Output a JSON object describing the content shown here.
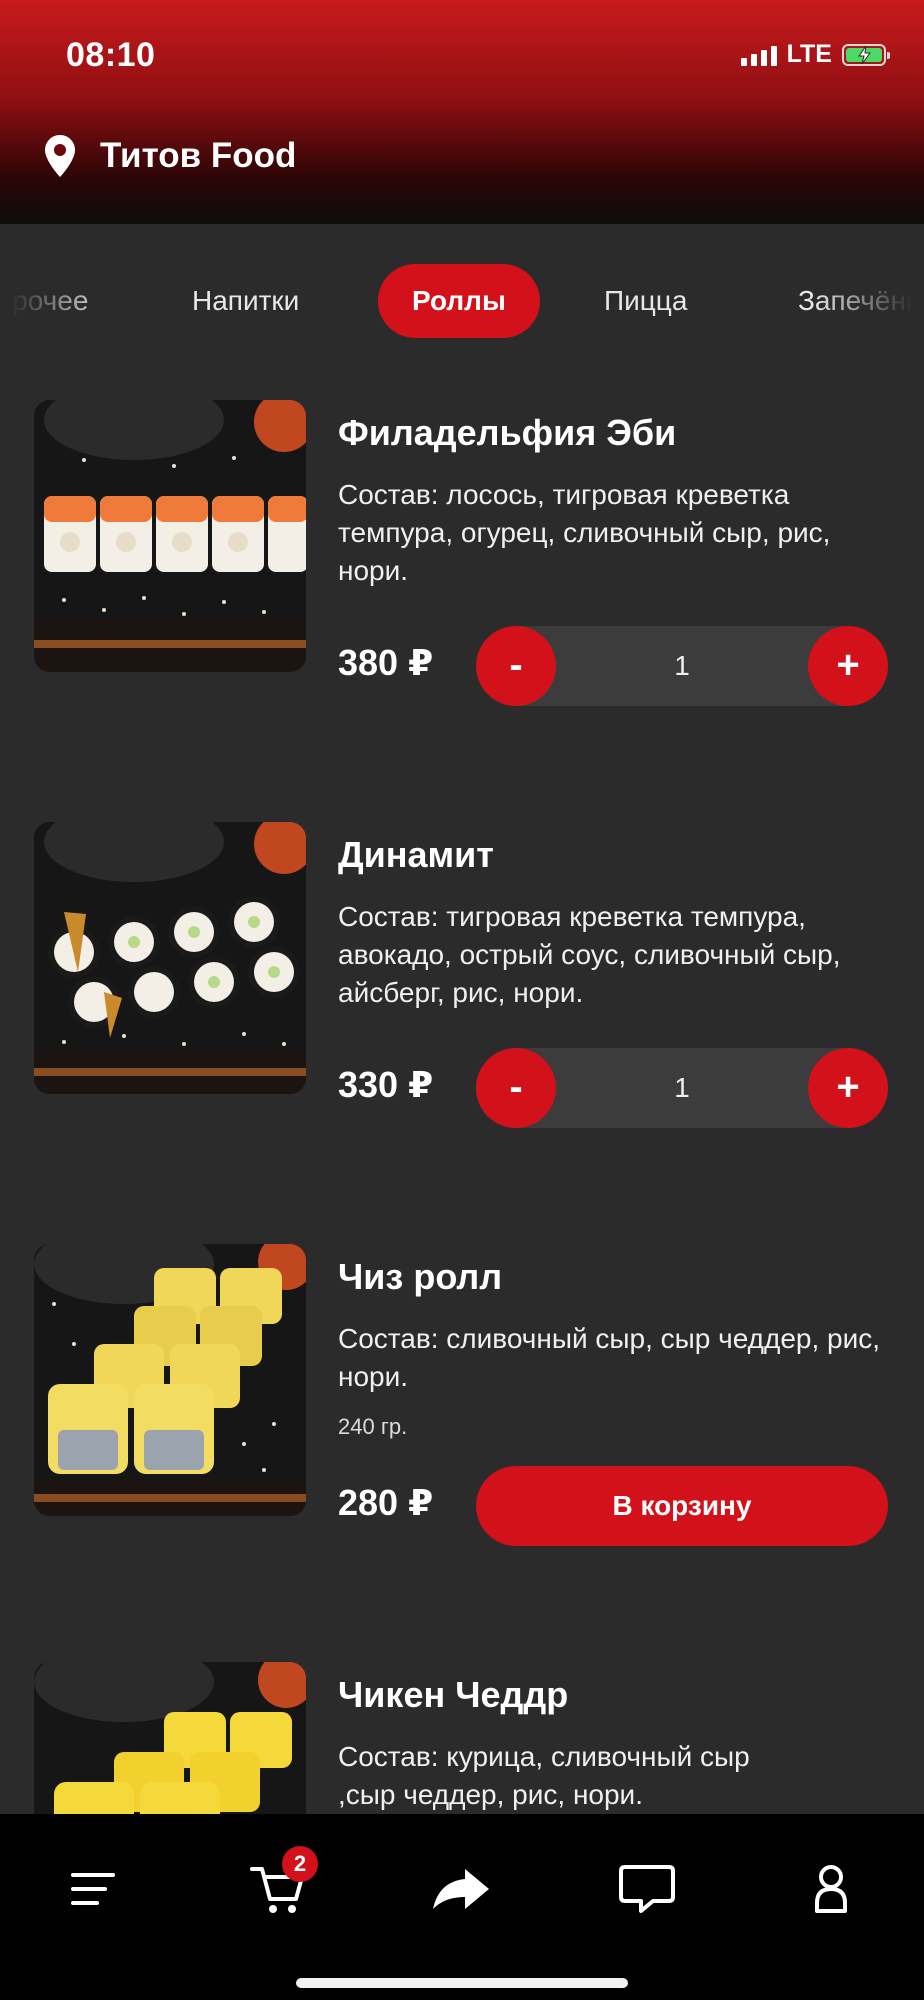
{
  "status_bar": {
    "time": "08:10",
    "network": "LTE",
    "battery_color": "#4cd964"
  },
  "header": {
    "location_icon": "map-pin-icon",
    "app_title": "Титов Food",
    "accent_color": "#d2111b"
  },
  "categories": {
    "items": [
      "Прочее",
      "Напитки",
      "Роллы",
      "Пицца",
      "Запечённые"
    ],
    "selected": "Роллы"
  },
  "products": [
    {
      "name": "Филадельфия Эби",
      "description": "Состав: лосось, тигровая креветка темпура, огурец, сливочный сыр, рис, нори.",
      "price": "380 ₽",
      "quantity": "1",
      "minus_label": "-",
      "plus_label": "+"
    },
    {
      "name": "Динамит",
      "description": "Состав: тигровая креветка темпура, авокадо, острый соус, сливочный сыр, айсберг, рис, нори.",
      "price": "330 ₽",
      "quantity": "1",
      "minus_label": "-",
      "plus_label": "+"
    },
    {
      "name": "Чиз ролл",
      "description": "Состав: сливочный сыр, сыр чеддер, рис, нори.",
      "weight": "240 гр.",
      "price": "280 ₽",
      "add_to_cart_label": "В корзину"
    },
    {
      "name": "Чикен Чеддр",
      "description": "Состав: курица, сливочный сыр ,сыр чеддер, рис, нори."
    }
  ],
  "bottom_nav": {
    "items": [
      "menu-icon",
      "cart-icon",
      "share-icon",
      "chat-icon",
      "profile-icon"
    ],
    "cart_badge": "2"
  }
}
